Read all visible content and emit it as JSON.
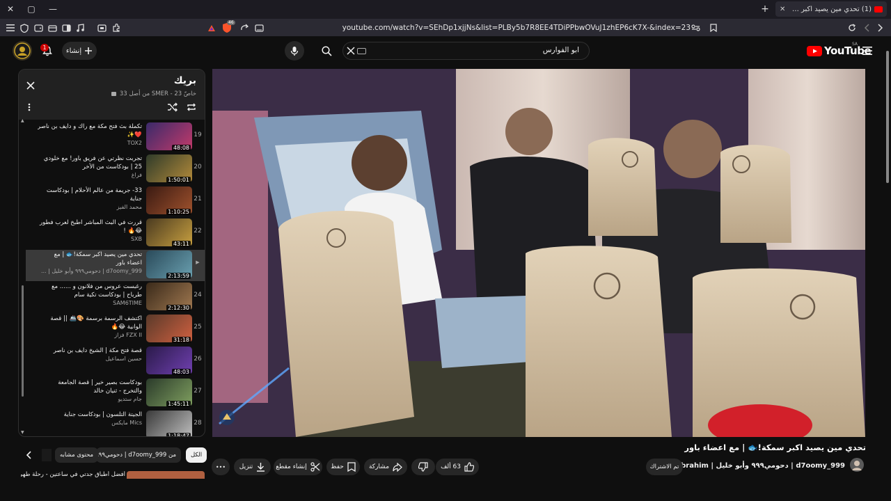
{
  "browser": {
    "tab": {
      "title": "(1) تحدي مين يصيد اكبر سمكة🐟 | مع اعضاء باور",
      "favicon": "youtube-favicon",
      "close": "✕"
    },
    "new_tab": "+",
    "window_controls": {
      "close": "✕",
      "restore": "▢",
      "minimize": "—"
    },
    "url": "youtube.com/watch?v=SEhDp1xjjNs&list=PLBy5b7R8EE4TDiPPbwOVuJ1zhEP6cK7X-&index=23",
    "shield_badge": "46"
  },
  "header": {
    "logo_text": "YouTube",
    "logo_region": "SA",
    "search_value": "ابو الفوارس",
    "create_label": "إنشاء",
    "notifications_count": "1"
  },
  "playlist": {
    "title": "بريك",
    "subtitle": "خاصّ SMER - 23 من أصل 33",
    "items": [
      {
        "num": "19",
        "title": "تكملة بث فتح مكة مع راك و دايف بن ناصر ❤️✨",
        "channel": "TOX2",
        "duration": "48:08",
        "thumb": [
          "#3a2a6a",
          "#c23a6a"
        ]
      },
      {
        "num": "20",
        "title": "تجربت نظرتي عن فريق باور! مع خلودي 25 | بودكاست من الأخر",
        "channel": "فراغ",
        "duration": "1:50:01",
        "thumb": [
          "#2f3b2a",
          "#b38a3a"
        ]
      },
      {
        "num": "21",
        "title": "33- جريمة من عالم الأحلام | بودكاست جناية",
        "channel": "محمد الفيز",
        "duration": "1:10:25",
        "thumb": [
          "#3a1a12",
          "#a0522d"
        ]
      },
      {
        "num": "22",
        "title": "قررت في البث المباشر اطبخ لعرب فطور 😂🔥 !",
        "channel": "SXB",
        "duration": "43:11",
        "thumb": [
          "#4a3a20",
          "#c8a040"
        ]
      },
      {
        "num": "",
        "title": "تحدي مين يصيد اكبر سمكة!🐟 | مع اعضاء باور",
        "channel": "d7oomy_999 | دحومي٩٩٩ وأبو خليل | ...",
        "duration": "2:13:59",
        "thumb": [
          "#2a4a5a",
          "#6aa0b0"
        ],
        "active": true
      },
      {
        "num": "24",
        "title": "رغبست عروس من فلانون و ...... مع طرباح | بودكاست تكية سام",
        "channel": "SAM6TIME",
        "duration": "2:12:30",
        "thumb": [
          "#3a2a1a",
          "#a07850"
        ]
      },
      {
        "num": "25",
        "title": "اكتشف الرسمة برسمة 🎨🚢 || قصة الوانية 😂🔥",
        "channel": "FZX II فزاز",
        "duration": "31:18",
        "thumb": [
          "#5a3a2a",
          "#d06040"
        ]
      },
      {
        "num": "26",
        "title": "قصة فتح مكة | الشيخ دايف بن ناصر",
        "channel": "حسين اسماعيل",
        "duration": "48:03",
        "thumb": [
          "#2a1a4a",
          "#7040b0"
        ]
      },
      {
        "num": "27",
        "title": "بودكاست بصير خير | قصة الجامعة والتخرج - ثنيان خالد",
        "channel": "جام ستديو",
        "duration": "1:45:11",
        "thumb": [
          "#2a3a2a",
          "#80a060"
        ]
      },
      {
        "num": "28",
        "title": "الجيتة التلسون | بودكاست جناية",
        "channel": "Mics مايكس",
        "duration": "1:18:47",
        "thumb": [
          "#3a3a3a",
          "#c0c0c0"
        ]
      }
    ],
    "next_item_preview": "أفضل أطباق جدتي في ساعتين - رحلة طهي مع"
  },
  "video": {
    "title": "تحدي مين يصيد اكبر سمكة!🐟 | مع اعضاء باور",
    "channel_line": "d7oomy_999 | دحومي٩٩٩ وأبو خليل | Ibrahim",
    "subscribed_label": "تم الاشتراك",
    "likes": "63 ألف",
    "share_label": "مشاركة",
    "save_label": "حفظ",
    "clip_label": "إنشاء مقطع",
    "download_label": "تنزيل",
    "more_label": "•••"
  },
  "chips": [
    {
      "label": "الكل",
      "active": true
    },
    {
      "label": "من d7oomy_999 | دحومي٩٩٩"
    },
    {
      "label": "محتوى مشابه"
    }
  ],
  "colors": {
    "background": "#0f0f0f",
    "youtube_red": "#ff0000",
    "chip_bg": "#272727",
    "panel_header": "#212121"
  }
}
